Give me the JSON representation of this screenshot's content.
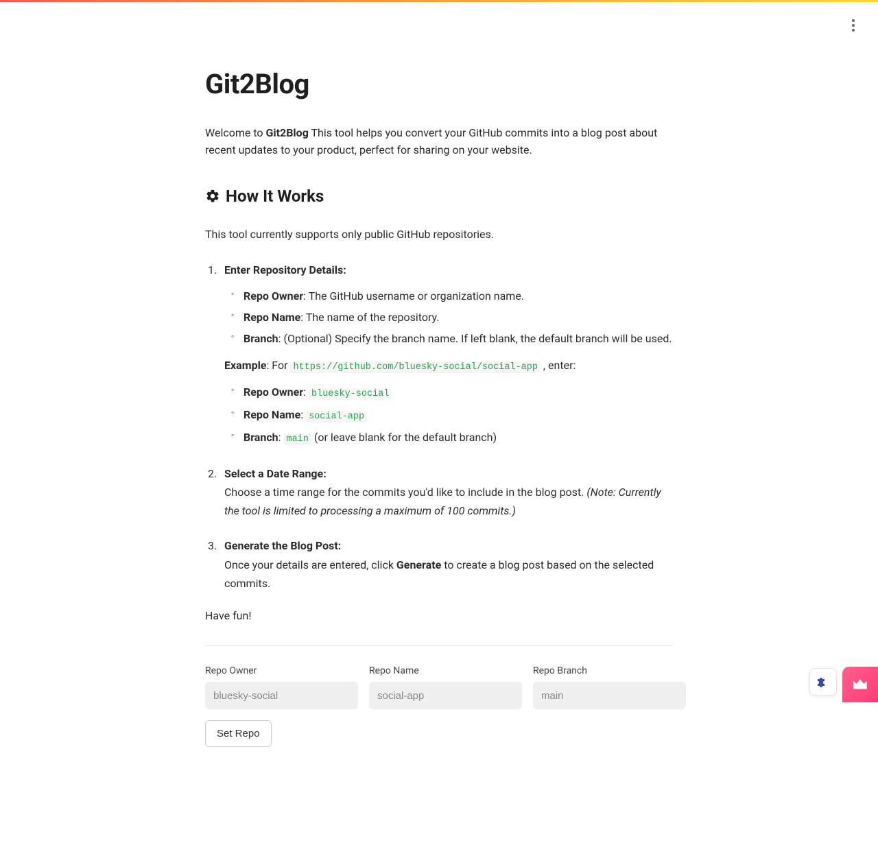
{
  "page": {
    "title": "Git2Blog",
    "intro_prefix": "Welcome to ",
    "intro_brand": "Git2Blog",
    "intro_rest": " This tool helps you convert your GitHub commits into a blog post about recent updates to your product, perfect for sharing on your website."
  },
  "how": {
    "heading": "How It Works",
    "support": "This tool currently supports only public GitHub repositories."
  },
  "steps": {
    "s1_title": "Enter Repository Details:",
    "s1_owner_label": "Repo Owner",
    "s1_owner_text": ": The GitHub username or organization name.",
    "s1_name_label": "Repo Name",
    "s1_name_text": ": The name of the repository.",
    "s1_branch_label": "Branch",
    "s1_branch_text": ": (Optional) Specify the branch name. If left blank, the default branch will be used.",
    "s1_example_label": "Example",
    "s1_example_for": ": For ",
    "s1_example_url": "https://github.com/bluesky-social/social-app",
    "s1_example_enter": " , enter:",
    "s1_ex_owner_label": "Repo Owner",
    "s1_ex_owner_val": "bluesky-social",
    "s1_ex_name_label": "Repo Name",
    "s1_ex_name_val": "social-app",
    "s1_ex_branch_label": "Branch",
    "s1_ex_branch_val": "main",
    "s1_ex_branch_tail": " (or leave blank for the default branch)",
    "s2_title": "Select a Date Range:",
    "s2_text": "Choose a time range for the commits you'd like to include in the blog post. ",
    "s2_note": "(Note: Currently the tool is limited to processing a maximum of 100 commits.)",
    "s3_title": "Generate the Blog Post:",
    "s3_text_a": "Once your details are entered, click ",
    "s3_generate": "Generate",
    "s3_text_b": " to create a blog post based on the selected commits."
  },
  "fun": "Have fun!",
  "form": {
    "owner_label": "Repo Owner",
    "owner_placeholder": "bluesky-social",
    "name_label": "Repo Name",
    "name_placeholder": "social-app",
    "branch_label": "Repo Branch",
    "branch_placeholder": "main",
    "set_repo": "Set Repo"
  }
}
